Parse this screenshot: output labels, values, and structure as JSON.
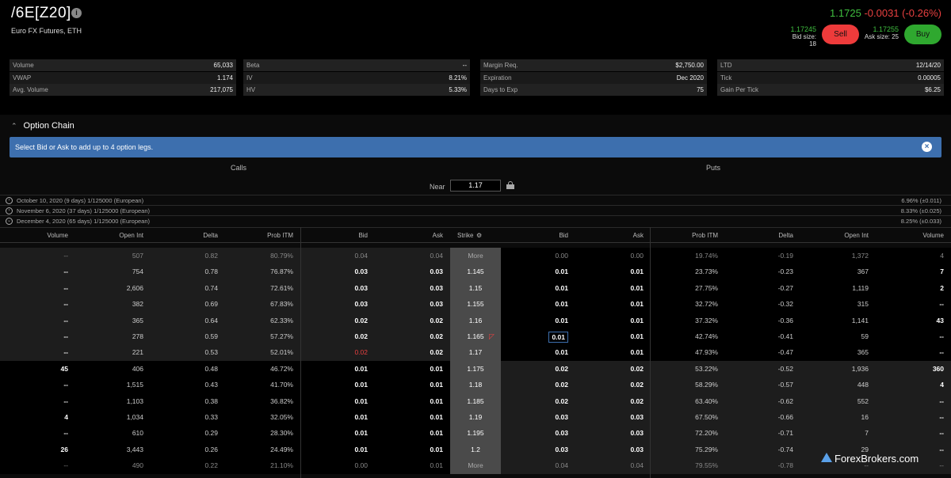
{
  "header": {
    "symbol": "/6E[Z20]",
    "subtitle": "Euro FX Futures, ETH",
    "last": "1.1725",
    "change": "-0.0031 (-0.26%)",
    "bid_price": "1.17245",
    "bid_size": "Bid size: 18",
    "ask_price": "1.17255",
    "ask_size": "Ask size: 25",
    "sell_label": "Sell",
    "buy_label": "Buy"
  },
  "stats": [
    [
      {
        "k": "Volume",
        "v": "65,033"
      },
      {
        "k": "VWAP",
        "v": "1.174"
      },
      {
        "k": "Avg. Volume",
        "v": "217,075"
      }
    ],
    [
      {
        "k": "Beta",
        "v": "--"
      },
      {
        "k": "IV",
        "v": "8.21%"
      },
      {
        "k": "HV",
        "v": "5.33%"
      }
    ],
    [
      {
        "k": "Margin Req.",
        "v": "$2,750.00"
      },
      {
        "k": "Expiration",
        "v": "Dec 2020"
      },
      {
        "k": "Days to Exp",
        "v": "75"
      }
    ],
    [
      {
        "k": "LTD",
        "v": "12/14/20"
      },
      {
        "k": "Tick",
        "v": "0.00005"
      },
      {
        "k": "Gain Per Tick",
        "v": "$6.25"
      }
    ]
  ],
  "chain": {
    "title": "Option Chain",
    "banner": "Select Bid or Ask to add up to 4 option legs.",
    "calls_label": "Calls",
    "puts_label": "Puts",
    "near_label": "Near",
    "near_value": "1.17",
    "expirations": [
      {
        "label": "October 10, 2020 (9 days) 1/125000 (European)",
        "iv": "6.96% (±0.011)"
      },
      {
        "label": "November 6, 2020 (37 days) 1/125000 (European)",
        "iv": "8.33% (±0.025)"
      },
      {
        "label": "December 4, 2020 (65 days) 1/125000 (European)",
        "iv": "8.25% (±0.033)"
      }
    ],
    "columns": {
      "c_volume": "Volume",
      "c_openint": "Open Int",
      "c_delta": "Delta",
      "c_probitm": "Prob ITM",
      "c_bid": "Bid",
      "c_ask": "Ask",
      "strike": "Strike",
      "p_bid": "Bid",
      "p_ask": "Ask",
      "p_probitm": "Prob ITM",
      "p_delta": "Delta",
      "p_openint": "Open Int",
      "p_volume": "Volume"
    },
    "rows": [
      {
        "cv": "--",
        "coi": "507",
        "cd": "0.82",
        "cp": "80.79%",
        "cb": "0.04",
        "ca": "0.04",
        "k": "More",
        "pb": "0.00",
        "pa": "0.00",
        "pp": "19.74%",
        "pd": "-0.19",
        "poi": "1,372",
        "pv": "4"
      },
      {
        "cv": "--",
        "coi": "754",
        "cd": "0.78",
        "cp": "76.87%",
        "cb": "0.03",
        "ca": "0.03",
        "k": "1.145",
        "pb": "0.01",
        "pa": "0.01",
        "pp": "23.73%",
        "pd": "-0.23",
        "poi": "367",
        "pv": "7"
      },
      {
        "cv": "--",
        "coi": "2,606",
        "cd": "0.74",
        "cp": "72.61%",
        "cb": "0.03",
        "ca": "0.03",
        "k": "1.15",
        "pb": "0.01",
        "pa": "0.01",
        "pp": "27.75%",
        "pd": "-0.27",
        "poi": "1,119",
        "pv": "2"
      },
      {
        "cv": "--",
        "coi": "382",
        "cd": "0.69",
        "cp": "67.83%",
        "cb": "0.03",
        "ca": "0.03",
        "k": "1.155",
        "pb": "0.01",
        "pa": "0.01",
        "pp": "32.72%",
        "pd": "-0.32",
        "poi": "315",
        "pv": "--"
      },
      {
        "cv": "--",
        "coi": "365",
        "cd": "0.64",
        "cp": "62.33%",
        "cb": "0.02",
        "ca": "0.02",
        "k": "1.16",
        "pb": "0.01",
        "pa": "0.01",
        "pp": "37.32%",
        "pd": "-0.36",
        "poi": "1,141",
        "pv": "43"
      },
      {
        "cv": "--",
        "coi": "278",
        "cd": "0.59",
        "cp": "57.27%",
        "cb": "0.02",
        "ca": "0.02",
        "k": "1.165",
        "pb": "0.01",
        "pa": "0.01",
        "pp": "42.74%",
        "pd": "-0.41",
        "poi": "59",
        "pv": "--"
      },
      {
        "cv": "--",
        "coi": "221",
        "cd": "0.53",
        "cp": "52.01%",
        "cb": "0.02",
        "ca": "0.02",
        "k": "1.17",
        "pb": "0.01",
        "pa": "0.01",
        "pp": "47.93%",
        "pd": "-0.47",
        "poi": "365",
        "pv": "--"
      },
      {
        "cv": "45",
        "coi": "406",
        "cd": "0.48",
        "cp": "46.72%",
        "cb": "0.01",
        "ca": "0.01",
        "k": "1.175",
        "pb": "0.02",
        "pa": "0.02",
        "pp": "53.22%",
        "pd": "-0.52",
        "poi": "1,936",
        "pv": "360"
      },
      {
        "cv": "--",
        "coi": "1,515",
        "cd": "0.43",
        "cp": "41.70%",
        "cb": "0.01",
        "ca": "0.01",
        "k": "1.18",
        "pb": "0.02",
        "pa": "0.02",
        "pp": "58.29%",
        "pd": "-0.57",
        "poi": "448",
        "pv": "4"
      },
      {
        "cv": "--",
        "coi": "1,103",
        "cd": "0.38",
        "cp": "36.82%",
        "cb": "0.01",
        "ca": "0.01",
        "k": "1.185",
        "pb": "0.02",
        "pa": "0.02",
        "pp": "63.40%",
        "pd": "-0.62",
        "poi": "552",
        "pv": "--"
      },
      {
        "cv": "4",
        "coi": "1,034",
        "cd": "0.33",
        "cp": "32.05%",
        "cb": "0.01",
        "ca": "0.01",
        "k": "1.19",
        "pb": "0.03",
        "pa": "0.03",
        "pp": "67.50%",
        "pd": "-0.66",
        "poi": "16",
        "pv": "--"
      },
      {
        "cv": "--",
        "coi": "610",
        "cd": "0.29",
        "cp": "28.30%",
        "cb": "0.01",
        "ca": "0.01",
        "k": "1.195",
        "pb": "0.03",
        "pa": "0.03",
        "pp": "72.20%",
        "pd": "-0.71",
        "poi": "7",
        "pv": "--"
      },
      {
        "cv": "26",
        "coi": "3,443",
        "cd": "0.26",
        "cp": "24.49%",
        "cb": "0.01",
        "ca": "0.01",
        "k": "1.2",
        "pb": "0.03",
        "pa": "0.03",
        "pp": "75.29%",
        "pd": "-0.74",
        "poi": "29",
        "pv": "--"
      },
      {
        "cv": "--",
        "coi": "490",
        "cd": "0.22",
        "cp": "21.10%",
        "cb": "0.00",
        "ca": "0.01",
        "k": "More",
        "pb": "0.04",
        "pa": "0.04",
        "pp": "79.55%",
        "pd": "-0.78",
        "poi": "--",
        "pv": "--"
      }
    ]
  },
  "colors": {
    "accent": "#3d6fae",
    "up": "#3fbf3f",
    "down": "#e84040",
    "sell": "#ee3b3b",
    "buy": "#2fa82f"
  },
  "watermark": "ForexBrokers.com"
}
